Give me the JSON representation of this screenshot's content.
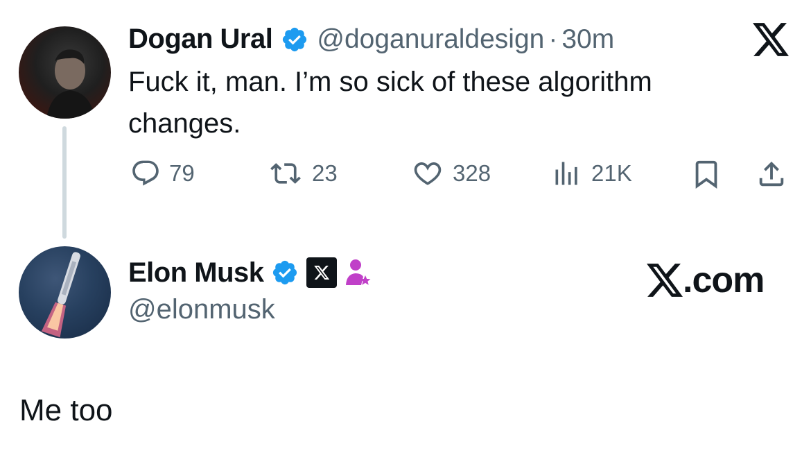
{
  "tweet": {
    "author_name": "Dogan Ural",
    "handle": "@doganuraldesign",
    "separator": "·",
    "time": "30m",
    "text": "Fuck it, man. I’m so sick of these algorithm changes.",
    "stats": {
      "replies": "79",
      "retweets": "23",
      "likes": "328",
      "views": "21K"
    }
  },
  "reply": {
    "author_name": "Elon Musk",
    "handle": "@elonmusk",
    "text": "Me too"
  },
  "watermark": "X.com",
  "colors": {
    "verified_blue": "#1d9bf0",
    "text_primary": "#0f1419",
    "text_secondary": "#536471",
    "thread_line": "#cfd9de",
    "affiliate_purple": "#c040c8"
  },
  "icons": [
    "x-logo-icon",
    "verified-badge-icon",
    "reply-icon",
    "retweet-icon",
    "like-icon",
    "views-icon",
    "bookmark-icon",
    "share-icon",
    "x-affiliate-badge-icon",
    "affiliate-person-icon"
  ]
}
